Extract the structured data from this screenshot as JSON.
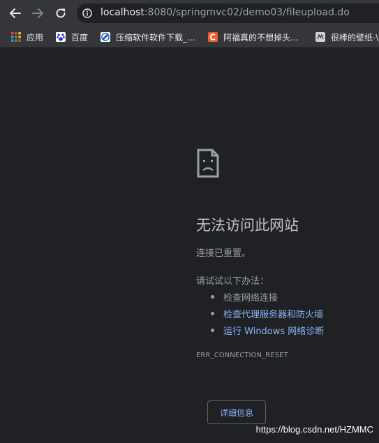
{
  "browser": {
    "url_host": "localhost",
    "url_rest": ":8080/springmvc02/demo03/fileupload.do"
  },
  "bookmarks": [
    {
      "label": "应用",
      "icon": "apps-grid-icon"
    },
    {
      "label": "百度",
      "icon": "baidu-paw-icon"
    },
    {
      "label": "压缩软件软件下载_...",
      "icon": "compress-software-icon"
    },
    {
      "label": "阿福真的不想掉头...",
      "icon": "csdn-c-icon"
    },
    {
      "label": "很棒的壁纸-\\",
      "icon": "wallpaper-site-icon"
    }
  ],
  "error": {
    "title": "无法访问此网站",
    "description": "连接已重置。",
    "try_label": "请试试以下办法：",
    "suggestions": [
      {
        "text": "检查网络连接",
        "is_link": false
      },
      {
        "text": "检查代理服务器和防火墙",
        "is_link": true
      },
      {
        "text": "运行 Windows 网络诊断",
        "is_link": true
      }
    ],
    "code": "ERR_CONNECTION_RESET",
    "details_label": "详细信息"
  },
  "watermark": "https://blog.csdn.net/HZMMC",
  "colors": {
    "background": "#202124",
    "toolbar": "#35363a",
    "link": "#8ab4f8",
    "text_muted": "#9aa0a6",
    "title": "#bdc1c6"
  }
}
